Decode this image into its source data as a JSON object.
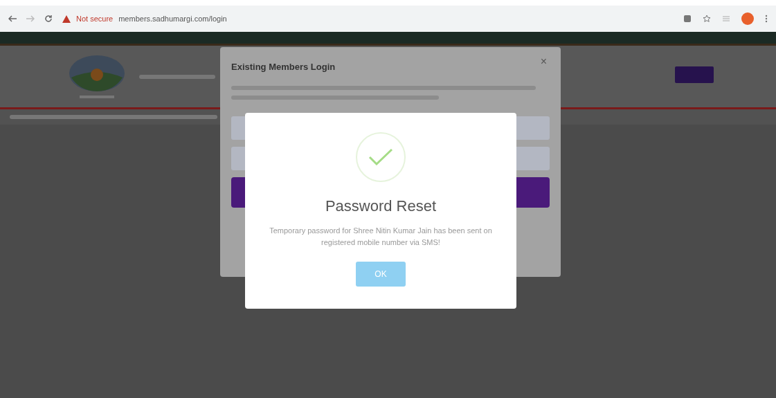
{
  "browser": {
    "security_label": "Not secure",
    "url": "members.sadhumargi.com/login"
  },
  "login_modal": {
    "title": "Existing Members Login",
    "close": "×"
  },
  "alert": {
    "title": "Password Reset",
    "message": "Temporary password for Shree Nitin Kumar Jain has been sent on registered mobile number via SMS!",
    "button": "OK"
  }
}
